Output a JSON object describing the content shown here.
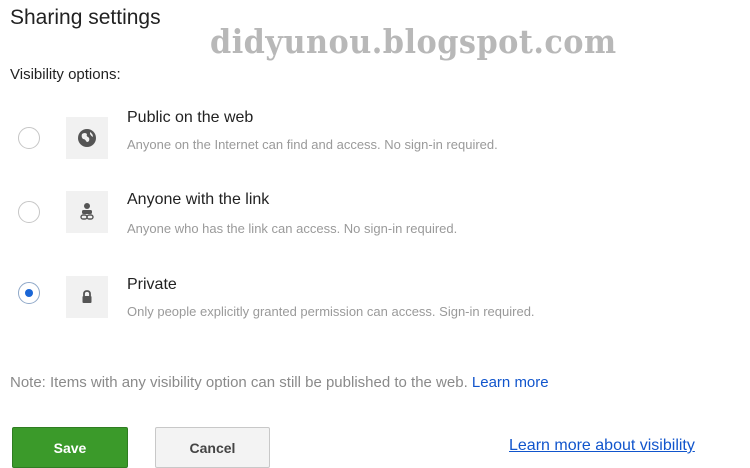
{
  "dialog": {
    "title": "Sharing settings",
    "watermark": "didyunou.blogspot.com",
    "section_label": "Visibility options:"
  },
  "options": [
    {
      "icon": "globe-icon",
      "title": "Public on the web",
      "description": "Anyone on the Internet can find and access. No sign-in required.",
      "selected": false
    },
    {
      "icon": "person-link-icon",
      "title": "Anyone with the link",
      "description": "Anyone who has the link can access. No sign-in required.",
      "selected": false
    },
    {
      "icon": "lock-icon",
      "title": "Private",
      "description": "Only people explicitly granted permission can access. Sign-in required.",
      "selected": true
    }
  ],
  "note": {
    "text": "Note: Items with any visibility option can still be published to the web.",
    "link": "Learn more"
  },
  "buttons": {
    "save": "Save",
    "cancel": "Cancel"
  },
  "learn_more_visibility": "Learn more about visibility",
  "colors": {
    "save_button": "#3b9a2a",
    "link": "#1155cc",
    "radio_selected": "#1a66d6",
    "description_text": "#9a9a9a"
  }
}
